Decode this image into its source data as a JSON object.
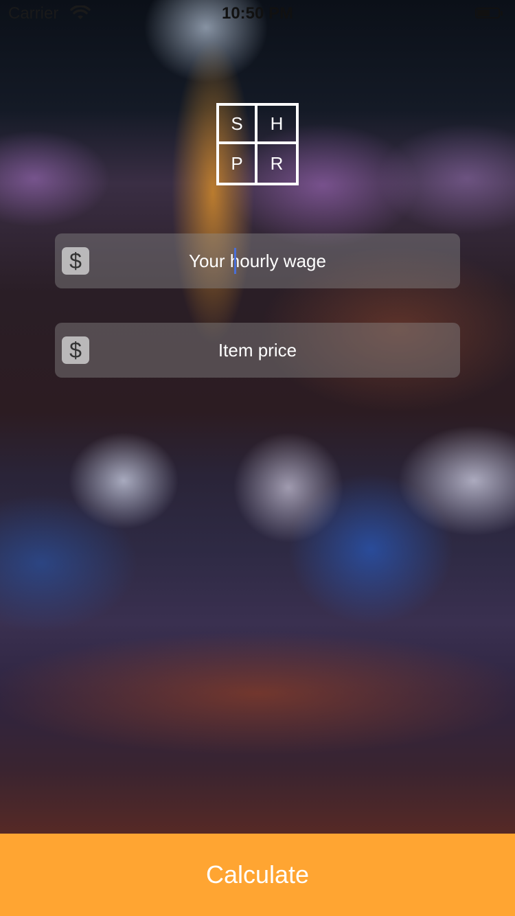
{
  "status_bar": {
    "carrier": "Carrier",
    "time": "10:50 PM",
    "wifi_icon": "wifi-icon",
    "battery_icon": "battery-icon"
  },
  "logo": {
    "letters": [
      "S",
      "H",
      "P",
      "R"
    ]
  },
  "wage_field": {
    "icon": "dollar-icon",
    "icon_glyph": "$",
    "placeholder": "Your hourly wage",
    "value": ""
  },
  "price_field": {
    "icon": "dollar-icon",
    "icon_glyph": "$",
    "placeholder": "Item price",
    "value": ""
  },
  "calculate_button": {
    "label": "Calculate",
    "color": "#ffa532"
  }
}
